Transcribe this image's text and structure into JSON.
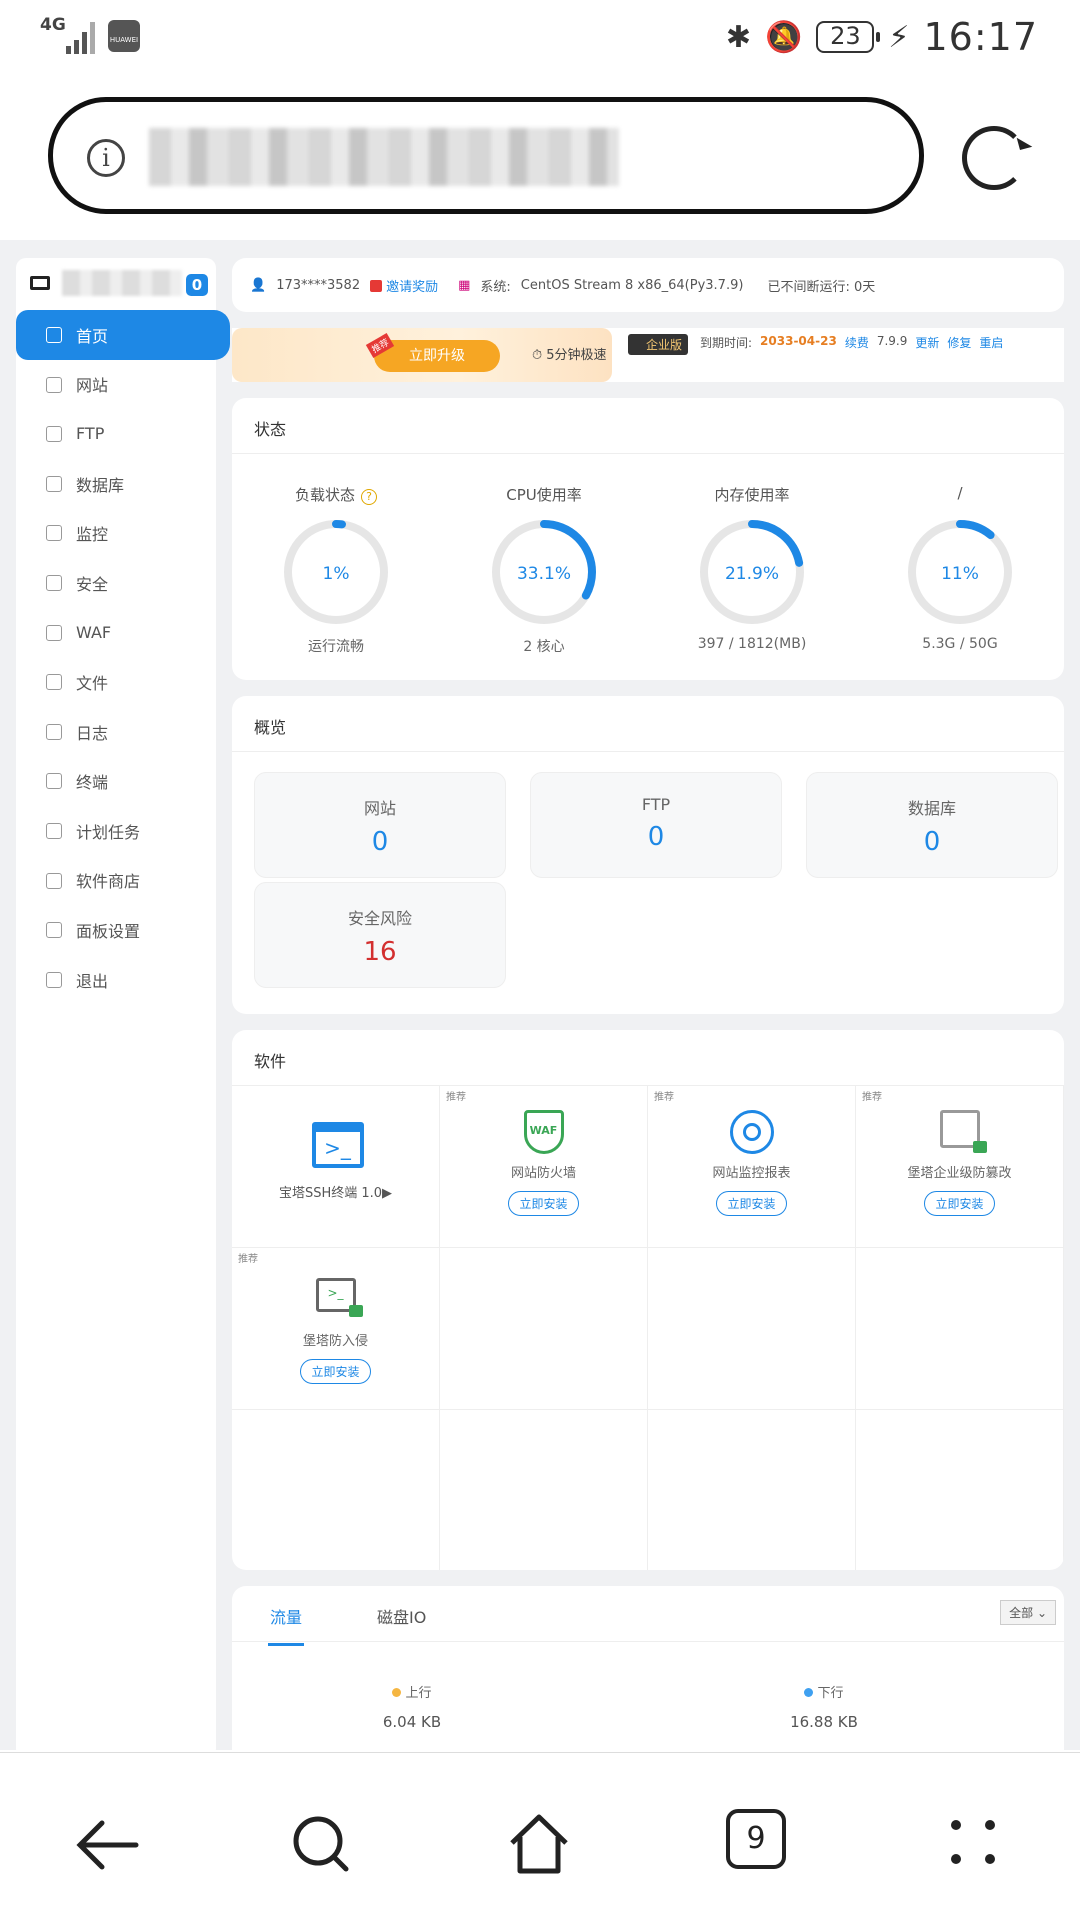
{
  "statusbar": {
    "network": "4G",
    "time": "16:17",
    "battery": "23"
  },
  "sidebar": {
    "badge": "0",
    "items": [
      {
        "label": "首页",
        "icon": "home-icon"
      },
      {
        "label": "网站",
        "icon": "globe-icon"
      },
      {
        "label": "FTP",
        "icon": "ftp-icon"
      },
      {
        "label": "数据库",
        "icon": "database-icon"
      },
      {
        "label": "监控",
        "icon": "monitor-icon"
      },
      {
        "label": "安全",
        "icon": "shield-icon"
      },
      {
        "label": "WAF",
        "icon": "waf-icon"
      },
      {
        "label": "文件",
        "icon": "folder-icon"
      },
      {
        "label": "日志",
        "icon": "log-icon"
      },
      {
        "label": "终端",
        "icon": "terminal-icon"
      },
      {
        "label": "计划任务",
        "icon": "calendar-icon"
      },
      {
        "label": "软件商店",
        "icon": "apps-icon"
      },
      {
        "label": "面板设置",
        "icon": "gear-icon"
      },
      {
        "label": "退出",
        "icon": "logout-icon"
      }
    ]
  },
  "infobar": {
    "user": "173****3582",
    "invite": "邀请奖励",
    "system_label": "系统:",
    "system": "CentOS Stream 8 x86_64(Py3.7.9)",
    "uptime": "已不间断运行: 0天"
  },
  "promo": {
    "tag": "推荐",
    "upgrade": "立即升级",
    "fast": "5分钟极速",
    "edition": "企业版",
    "expire_label": "到期时间:",
    "expire_date": "2033-04-23",
    "renew": "续费",
    "version": "7.9.9",
    "update": "更新",
    "repair": "修复",
    "restart": "重启"
  },
  "status": {
    "title": "状态",
    "gauges": [
      {
        "label": "负载状态",
        "value": "1%",
        "sub": "运行流畅",
        "fraction": 0.01,
        "help": "?"
      },
      {
        "label": "CPU使用率",
        "value": "33.1%",
        "sub": "2 核心",
        "fraction": 0.331
      },
      {
        "label": "内存使用率",
        "value": "21.9%",
        "sub": "397 / 1812(MB)",
        "fraction": 0.219
      },
      {
        "label": "/",
        "value": "11%",
        "sub": "5.3G / 50G",
        "fraction": 0.11
      }
    ]
  },
  "overview": {
    "title": "概览",
    "tiles": [
      {
        "label": "网站",
        "value": "0"
      },
      {
        "label": "FTP",
        "value": "0"
      },
      {
        "label": "数据库",
        "value": "0"
      },
      {
        "label": "安全风险",
        "value": "16"
      }
    ]
  },
  "software": {
    "title": "软件",
    "items": [
      {
        "name": "宝塔SSH终端 1.0▶",
        "tag": "",
        "install": ""
      },
      {
        "name": "网站防火墙",
        "tag": "推荐",
        "install": "立即安装"
      },
      {
        "name": "网站监控报表",
        "tag": "推荐",
        "install": "立即安装"
      },
      {
        "name": "堡塔企业级防篡改",
        "tag": "推荐",
        "install": "立即安装"
      },
      {
        "name": "堡塔防入侵",
        "tag": "推荐",
        "install": "立即安装"
      }
    ]
  },
  "traffic": {
    "tabs": [
      "流量",
      "磁盘IO"
    ],
    "select": "全部",
    "up_label": "上行",
    "up_value": "6.04 KB",
    "down_label": "下行",
    "down_value": "16.88 KB"
  },
  "navbar": {
    "tab_count": "9"
  },
  "colors": {
    "accent": "#1e88e5",
    "danger": "#d32f2f",
    "orange": "#e67e22"
  }
}
